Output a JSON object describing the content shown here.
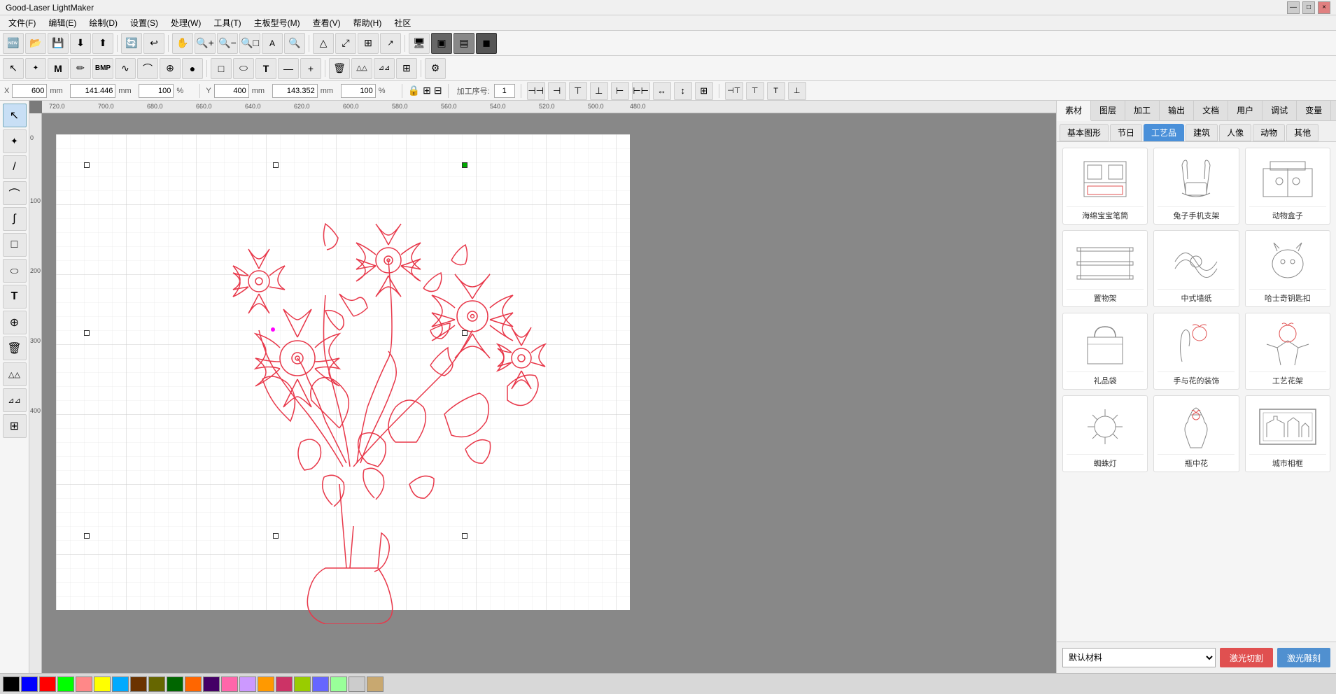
{
  "app": {
    "title": "Good-Laser LightMaker",
    "window_controls": [
      "—",
      "□",
      "×"
    ]
  },
  "menubar": {
    "items": [
      "文件(F)",
      "编辑(E)",
      "绘制(D)",
      "设置(S)",
      "处理(W)",
      "工具(T)",
      "主板型号(M)",
      "查看(V)",
      "帮助(H)",
      "社区"
    ]
  },
  "toolbar1": {
    "buttons": [
      "🆕",
      "📂",
      "💾",
      "⬇",
      "⬆",
      "🔄",
      "↩",
      "✋",
      "🔍+",
      "🔍-",
      "🔍□",
      "A",
      "🔍",
      "△▽",
      "⤢",
      "≡",
      "⬜",
      "↗"
    ],
    "separator_positions": [
      3,
      6,
      8
    ]
  },
  "toolbar2": {
    "buttons": [
      "↖",
      "✎",
      "M",
      "✏",
      "BMP",
      "∿",
      "⌒",
      "⊕",
      "●",
      "□",
      "◯",
      "T",
      "—",
      "+",
      "🗑",
      "△△",
      "⊿⊿",
      "⊞"
    ]
  },
  "propsbar": {
    "x_label": "X",
    "x_value": "600",
    "x_unit": "mm",
    "x2_value": "141.446",
    "x2_unit": "mm",
    "x3_value": "100",
    "x3_unit": "%",
    "y_label": "Y",
    "y_value": "400",
    "y_unit": "mm",
    "y2_value": "143.352",
    "y2_unit": "mm",
    "y3_value": "100",
    "y3_unit": "%",
    "lock_icon": "🔒",
    "grid_icon": "⊞",
    "processing_label": "加工序号:",
    "processing_value": "1",
    "align_buttons": [
      "⊣⊣",
      "⊣",
      "⊤",
      "⊥",
      "⊢",
      "⊢⊢",
      "—",
      "↔",
      "⊤",
      "⊥",
      "⊞",
      "⊣⊣",
      "⊤⊤",
      "⊥⊥",
      "⊢⊢"
    ]
  },
  "toolbox": {
    "tools": [
      {
        "name": "select",
        "icon": "↖",
        "active": true
      },
      {
        "name": "node-edit",
        "icon": "⤢"
      },
      {
        "name": "line",
        "icon": "/"
      },
      {
        "name": "polyline",
        "icon": "⌒"
      },
      {
        "name": "bezier",
        "icon": "∫"
      },
      {
        "name": "rectangle",
        "icon": "□"
      },
      {
        "name": "ellipse",
        "icon": "⬭"
      },
      {
        "name": "text",
        "icon": "T"
      },
      {
        "name": "measure",
        "icon": "⊕"
      },
      {
        "name": "delete",
        "icon": "🗑"
      },
      {
        "name": "mirror-h",
        "icon": "△△"
      },
      {
        "name": "mirror-v",
        "icon": "⊿⊿"
      },
      {
        "name": "array",
        "icon": "⊞"
      }
    ]
  },
  "canvas": {
    "background": "#888888",
    "ruler_marks_h": [
      "720.0",
      "700.0",
      "680.0",
      "660.0",
      "640.0",
      "620.0",
      "600.0",
      "580.0",
      "560.0",
      "540.0",
      "520.0",
      "500.0",
      "480.0"
    ],
    "ruler_marks_v": [
      "0",
      "100",
      "200",
      "300",
      "400"
    ]
  },
  "rightpanel": {
    "tabs": [
      {
        "label": "素材",
        "active": true
      },
      {
        "label": "图层",
        "active": false
      },
      {
        "label": "加工",
        "active": false
      },
      {
        "label": "输出",
        "active": false
      },
      {
        "label": "文档",
        "active": false
      },
      {
        "label": "用户",
        "active": false
      },
      {
        "label": "调试",
        "active": false
      },
      {
        "label": "变量",
        "active": false
      }
    ],
    "subtabs": [
      {
        "label": "基本图形",
        "active": false
      },
      {
        "label": "节日",
        "active": false
      },
      {
        "label": "工艺品",
        "active": true
      },
      {
        "label": "建筑",
        "active": false
      },
      {
        "label": "人像",
        "active": false
      },
      {
        "label": "动物",
        "active": false
      },
      {
        "label": "其他",
        "active": false
      }
    ],
    "assets": [
      {
        "label": "海绵宝宝笔筒",
        "icon": "📦"
      },
      {
        "label": "兔子手机支架",
        "icon": "🐰"
      },
      {
        "label": "动物盒子",
        "icon": "📦"
      },
      {
        "label": "置物架",
        "icon": "🗄"
      },
      {
        "label": "中式墙纸",
        "icon": "🖼"
      },
      {
        "label": "哈士奇钥匙扣",
        "icon": "🐕"
      },
      {
        "label": "礼品袋",
        "icon": "👜"
      },
      {
        "label": "手与花的装饰",
        "icon": "🌸"
      },
      {
        "label": "工艺花架",
        "icon": "🌺"
      },
      {
        "label": "蜘蛛灯",
        "icon": "🕷"
      },
      {
        "label": "瓶中花",
        "icon": "🌹"
      },
      {
        "label": "城市相框",
        "icon": "🏙"
      }
    ],
    "footer": {
      "material_label": "默认材料",
      "btn_cut": "激光切割",
      "btn_engrave": "激光雕刻"
    }
  },
  "colorbar": {
    "colors": [
      "#000000",
      "#0000ff",
      "#ff0000",
      "#00ff00",
      "#ff8888",
      "#ffff00",
      "#00aaff",
      "#6b3300",
      "#666600",
      "#006600",
      "#ff6600",
      "#440066",
      "#ff66aa",
      "#cc99ff",
      "#ff9900",
      "#cc3366",
      "#99cc00",
      "#6666ff",
      "#99ff99",
      "#cccccc"
    ]
  }
}
